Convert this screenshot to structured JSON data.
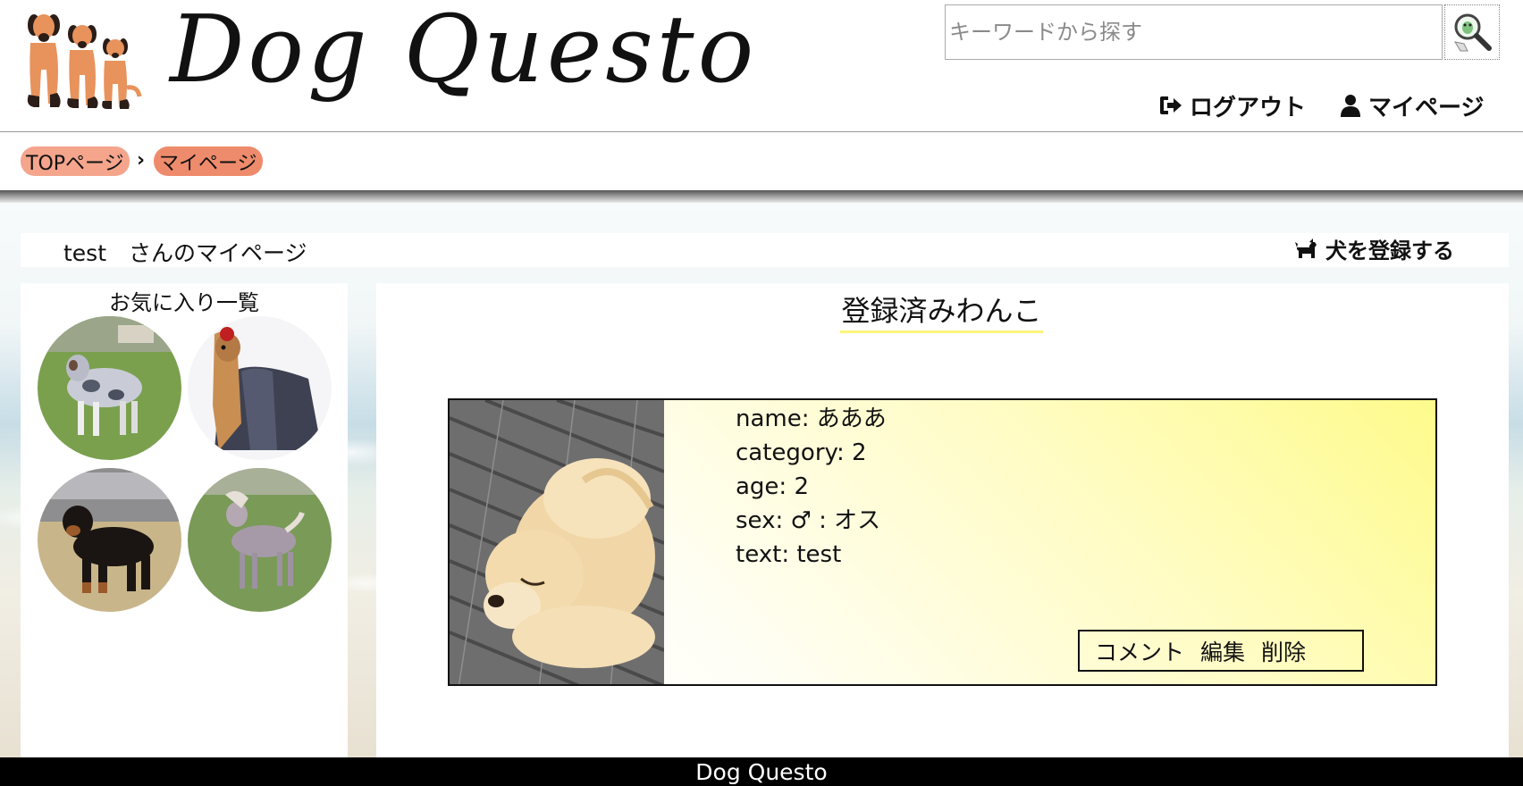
{
  "header": {
    "logo_text": "Dog Questo",
    "search": {
      "placeholder": "キーワードから探す",
      "value": ""
    },
    "nav": {
      "logout_label": "ログアウト",
      "mypage_label": "マイページ"
    }
  },
  "breadcrumb": {
    "items": [
      "TOPページ",
      "マイページ"
    ],
    "separator": "›"
  },
  "page": {
    "user_title": "test　さんのマイページ",
    "register_label": "犬を登録する"
  },
  "favorites": {
    "title": "お気に入り一覧",
    "count": 4
  },
  "registered": {
    "title": "登録済みわんこ",
    "dog": {
      "name": "name: あああ",
      "category": "category: 2",
      "age": "age: 2",
      "sex": "sex: ♂ : オス",
      "text": "text: test"
    },
    "actions": {
      "comment": "コメント",
      "edit": "編集",
      "delete": "削除"
    }
  },
  "footer": {
    "text": "Dog Questo"
  },
  "colors": {
    "crumb_top": "#f4a58c",
    "crumb_current": "#ee8b6c",
    "title_underline": "#fbf47a",
    "card_gradient_start": "#fefb8c",
    "footer_bg": "#000000"
  },
  "icons": {
    "logo": "three-dogs-logo",
    "search_button": "magnifier-dog-icon",
    "logout": "sign-out-icon",
    "mypage": "user-icon",
    "register": "dog-icon"
  }
}
